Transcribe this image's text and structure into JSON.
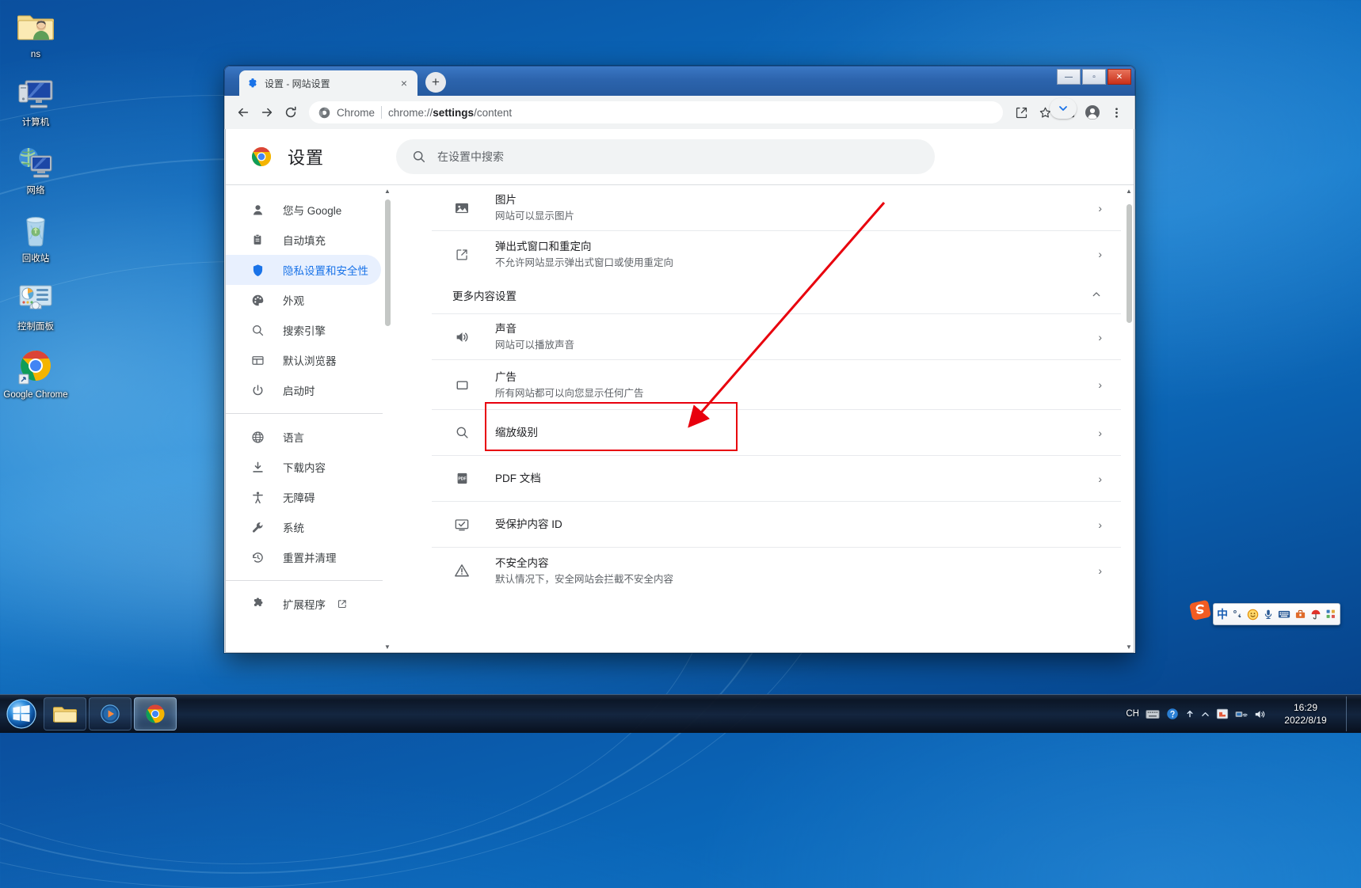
{
  "desktop": {
    "icons": [
      {
        "name": "ns",
        "icon": "user-folder-icon"
      },
      {
        "name": "计算机",
        "icon": "computer-icon"
      },
      {
        "name": "网络",
        "icon": "network-icon"
      },
      {
        "name": "回收站",
        "icon": "recycle-bin-icon"
      },
      {
        "name": "控制面板",
        "icon": "control-panel-icon"
      },
      {
        "name": "Google Chrome",
        "icon": "chrome-shortcut-icon"
      }
    ]
  },
  "window": {
    "tab": {
      "title": "设置 - 网站设置",
      "favicon": "gear-icon",
      "close": "×"
    },
    "new_tab_label": "+",
    "controls": {
      "minimize": "—",
      "maximize": "▫",
      "close": "✕"
    },
    "toolbar": {
      "back": "←",
      "forward": "→",
      "reload": "⟳",
      "omnibox": {
        "scheme_label": "Chrome",
        "url_faint": "chrome://",
        "url_strong": "settings",
        "url_tail": "/content",
        "full_url": "chrome://settings/content"
      },
      "share": "share-icon",
      "bookmark": "star-icon",
      "sidepanel": "side-panel-icon",
      "profile": "profile-icon",
      "menu": "three-dot-menu-icon"
    }
  },
  "settings": {
    "title": "设置",
    "search": {
      "placeholder": "在设置中搜索",
      "value": ""
    },
    "sidebar": {
      "items": [
        {
          "label": "您与 Google",
          "icon": "person-icon",
          "active": false
        },
        {
          "label": "自动填充",
          "icon": "clipboard-icon",
          "active": false
        },
        {
          "label": "隐私设置和安全性",
          "icon": "shield-icon",
          "active": true
        },
        {
          "label": "外观",
          "icon": "palette-icon",
          "active": false
        },
        {
          "label": "搜索引擎",
          "icon": "search-icon",
          "active": false
        },
        {
          "label": "默认浏览器",
          "icon": "browser-window-icon",
          "active": false
        },
        {
          "label": "启动时",
          "icon": "power-icon",
          "active": false
        }
      ],
      "items2": [
        {
          "label": "语言",
          "icon": "globe-icon",
          "active": false
        },
        {
          "label": "下载内容",
          "icon": "download-icon",
          "active": false
        },
        {
          "label": "无障碍",
          "icon": "accessibility-icon",
          "active": false
        },
        {
          "label": "系统",
          "icon": "wrench-icon",
          "active": false
        },
        {
          "label": "重置并清理",
          "icon": "history-restore-icon",
          "active": false
        }
      ],
      "extensions": {
        "label": "扩展程序",
        "icon": "puzzle-icon",
        "external": "external-link-icon"
      }
    },
    "content_rows_top": [
      {
        "title": "图片",
        "sub": "网站可以显示图片",
        "icon": "image-icon",
        "arrow": "›"
      },
      {
        "title": "弹出式窗口和重定向",
        "sub": "不允许网站显示弹出式窗口或使用重定向",
        "icon": "popup-redirect-icon",
        "arrow": "›"
      }
    ],
    "section": {
      "label": "更多内容设置",
      "caret": "⌃"
    },
    "content_rows_more": [
      {
        "title": "声音",
        "sub": "网站可以播放声音",
        "icon": "volume-icon",
        "arrow": "›",
        "highlight": false
      },
      {
        "title": "广告",
        "sub": "所有网站都可以向您显示任何广告",
        "icon": "ads-icon",
        "arrow": "›",
        "highlight": true
      },
      {
        "title": "缩放级别",
        "sub": "",
        "icon": "search-icon",
        "arrow": "›",
        "highlight": false
      },
      {
        "title": "PDF 文档",
        "sub": "",
        "icon": "pdf-icon",
        "arrow": "›",
        "highlight": false
      },
      {
        "title": "受保护内容 ID",
        "sub": "",
        "icon": "protected-content-icon",
        "arrow": "›",
        "highlight": false
      },
      {
        "title": "不安全内容",
        "sub": "默认情况下，安全网站会拦截不安全内容",
        "icon": "warning-icon",
        "arrow": "›",
        "highlight": false
      }
    ]
  },
  "annotation": {
    "box_color": "#e8000d",
    "arrow_color": "#e8000d"
  },
  "ime": {
    "name": "sogou-input-method",
    "logo": "sogou-s-logo",
    "mode_label": "中",
    "icons": [
      "punctuation-icon",
      "smiley-icon",
      "microphone-icon",
      "keyboard-icon",
      "toolbox-icon",
      "umbrella-icon",
      "apps-icon"
    ]
  },
  "taskbar": {
    "start": "start-orb",
    "buttons": [
      {
        "name": "explorer-taskbar-button",
        "icon": "folder-icon",
        "active": false
      },
      {
        "name": "media-player-taskbar-button",
        "icon": "play-icon",
        "active": false
      },
      {
        "name": "chrome-taskbar-button",
        "icon": "chrome-icon",
        "active": true
      }
    ],
    "tray": {
      "lang": "CH",
      "icons": [
        "ime-tray-icon",
        "help-icon",
        "arrow-up-icon",
        "caret-up-icon",
        "flag-icon",
        "network-icon",
        "volume-icon"
      ]
    },
    "clock": {
      "time": "16:29",
      "date": "2022/8/19"
    }
  }
}
